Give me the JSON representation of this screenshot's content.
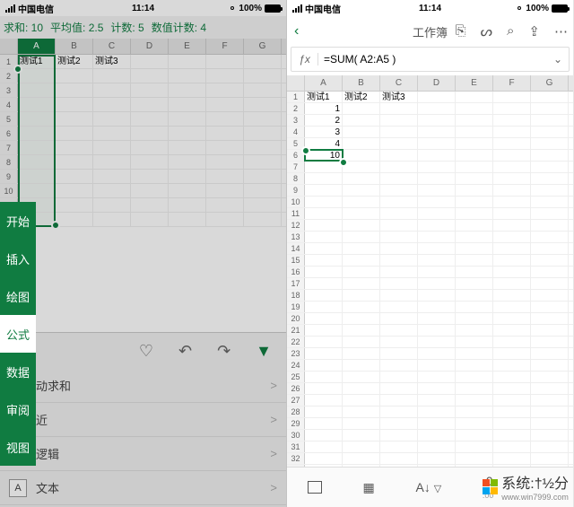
{
  "status": {
    "carrier": "中国电信",
    "time": "11:14",
    "battery": "100%"
  },
  "left": {
    "summary": {
      "sum": "求和: 10",
      "avg": "平均值: 2.5",
      "count": "计数: 5",
      "numcount": "数值计数: 4"
    },
    "cols": [
      "A",
      "B",
      "C",
      "D",
      "E",
      "F",
      "G"
    ],
    "headers": {
      "A": "测试1",
      "B": "测试2",
      "C": "测试3"
    },
    "ribbon": [
      "开始",
      "插入",
      "绘图",
      "公式",
      "数据",
      "审阅",
      "视图"
    ],
    "ribbon_active_index": 3,
    "icons": {
      "lightbulb": "lightbulb-icon",
      "undo": "undo-icon",
      "redo": "redo-icon",
      "collapse": "collapse-icon"
    },
    "fn_list": [
      {
        "icon": "fx",
        "label": "动求和",
        "chev": ">"
      },
      {
        "icon": "★",
        "label": "近",
        "chev": ">"
      },
      {
        "icon": "?",
        "label": "逻辑",
        "chev": ">"
      },
      {
        "icon": "A",
        "label": "文本",
        "chev": ">"
      }
    ]
  },
  "right": {
    "title": "工作簿",
    "formula": "=SUM( A2:A5 )",
    "cols": [
      "A",
      "B",
      "C",
      "D",
      "E",
      "F",
      "G"
    ],
    "headers": {
      "A": "测试1",
      "B": "测试2",
      "C": "测试3"
    },
    "values": {
      "A2": "1",
      "A3": "2",
      "A4": "3",
      "A5": "4",
      "A6": "10"
    },
    "bottom_decimal": ".0",
    "bottom_decimal_sub": ".00"
  },
  "watermark": {
    "text": "系统:†½分",
    "url": "www.win7999.com"
  }
}
